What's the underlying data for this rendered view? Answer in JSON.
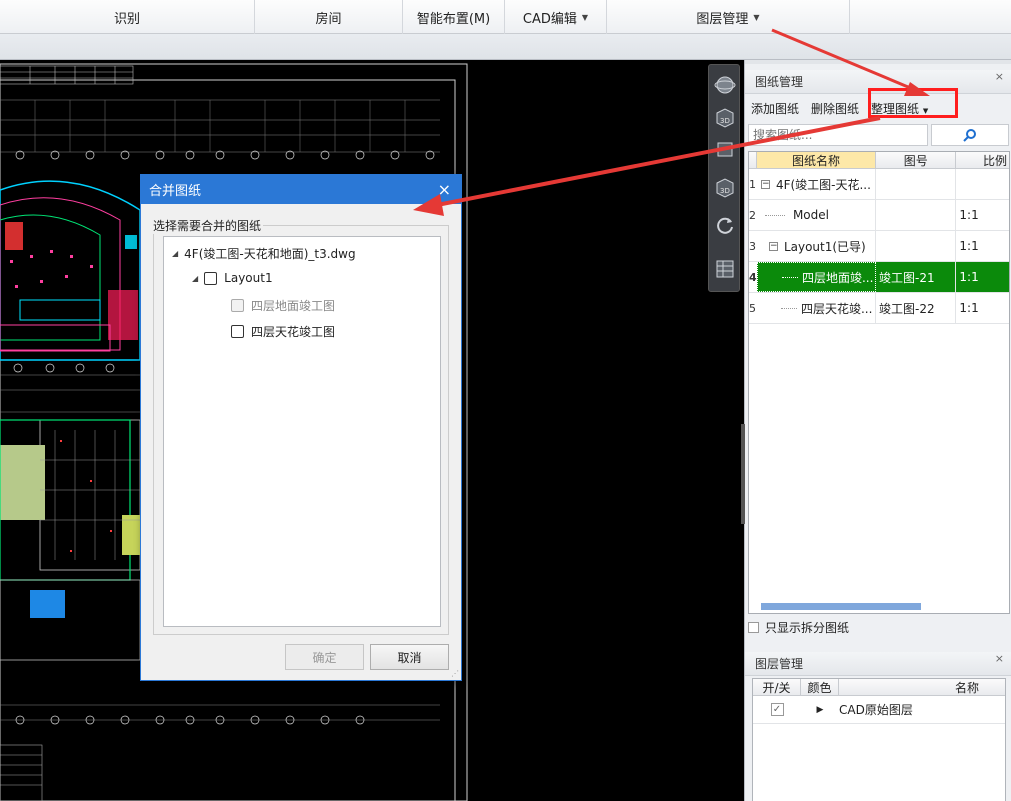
{
  "toolbar": {
    "items": [
      {
        "label": "识别",
        "has_arrow": false
      },
      {
        "label": "房间",
        "has_arrow": false
      },
      {
        "label": "智能布置(M)",
        "has_arrow": false
      },
      {
        "label": "CAD编辑",
        "has_arrow": true
      },
      {
        "label": "图层管理",
        "has_arrow": true
      }
    ]
  },
  "drawing_panel": {
    "title": "图纸管理",
    "close": "×",
    "actions": {
      "add": "添加图纸",
      "delete": "删除图纸",
      "organize": "整理图纸"
    },
    "search": {
      "placeholder": "搜索图纸..."
    },
    "columns": {
      "name": "图纸名称",
      "number": "图号",
      "scale": "比例"
    },
    "rows": [
      {
        "index": "1",
        "name": "4F(竣工图-天花...",
        "number": "",
        "scale": ""
      },
      {
        "index": "2",
        "name": "Model",
        "number": "",
        "scale": "1:1"
      },
      {
        "index": "3",
        "name": "Layout1(已导)",
        "number": "",
        "scale": "1:1"
      },
      {
        "index": "4",
        "name": "四层地面竣...",
        "number": "竣工图-21",
        "scale": "1:1"
      },
      {
        "index": "5",
        "name": "四层天花竣...",
        "number": "竣工图-22",
        "scale": "1:1"
      }
    ],
    "only_split_label": "只显示拆分图纸"
  },
  "layer_panel": {
    "title": "图层管理",
    "close": "×",
    "columns": {
      "toggle": "开/关",
      "color": "颜色",
      "name": "名称"
    },
    "rows": [
      {
        "name": "CAD原始图层"
      }
    ]
  },
  "dialog": {
    "title": "合并图纸",
    "close": "×",
    "group_label": "选择需要合并的图纸",
    "tree": {
      "root": "4F(竣工图-天花和地面)_t3.dwg",
      "layout": "Layout1",
      "children": [
        {
          "label": "四层地面竣工图",
          "disabled": true
        },
        {
          "label": "四层天花竣工图",
          "disabled": false
        }
      ]
    },
    "ok": "确定",
    "cancel": "取消"
  },
  "viewbar": {
    "labels": [
      "3D",
      "3D",
      "3D"
    ]
  },
  "colors": {
    "accent": "#2b78d6",
    "selected_row": "#0b8a0b",
    "highlight": "#ff1e1e",
    "arrow": "#e53935"
  }
}
